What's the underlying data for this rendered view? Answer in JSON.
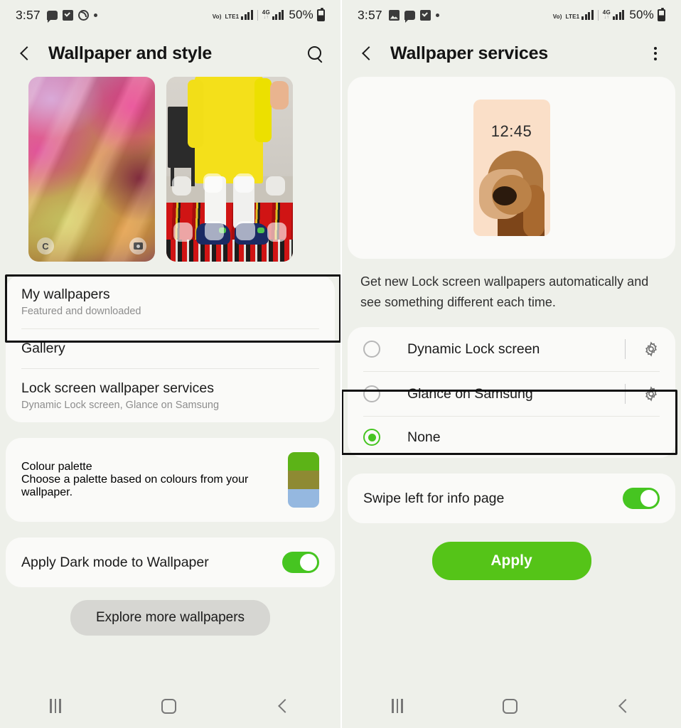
{
  "left": {
    "status_bar": {
      "time": "3:57",
      "left_icons": [
        "chat-icon",
        "checkbox-icon",
        "circle-progress-icon",
        "dot-icon"
      ],
      "network_label": "Vo)",
      "network_label2": "LTE1",
      "data_label": "4G",
      "data_arrows": "↓↑",
      "battery_percent": "50%"
    },
    "appbar": {
      "title": "Wallpaper and style",
      "back": "back-chevron",
      "search": "search-icon"
    },
    "previews": [
      {
        "name": "silk-wallpaper-thumbnail",
        "lock_glyph": "C",
        "camera_glyph": "camera-icon"
      },
      {
        "name": "photo-wallpaper-thumbnail"
      }
    ],
    "list": [
      {
        "title": "My wallpapers",
        "sub": "Featured and downloaded",
        "highlighted": true
      },
      {
        "title": "Gallery",
        "sub": ""
      },
      {
        "title": "Lock screen wallpaper services",
        "sub": "Dynamic Lock screen, Glance on Samsung"
      }
    ],
    "palette": {
      "title": "Colour palette",
      "sub": "Choose a palette based on colours from your wallpaper.",
      "swatch_colors": [
        "#5cb317",
        "#8e8a33",
        "#95b8e0"
      ]
    },
    "dark_mode": {
      "title": "Apply Dark mode to Wallpaper",
      "enabled": true
    },
    "explore_button": "Explore more wallpapers",
    "navbar": [
      "recents-button",
      "home-button",
      "back-button"
    ]
  },
  "right": {
    "status_bar": {
      "time": "3:57",
      "left_icons": [
        "image-icon",
        "chat-icon",
        "checkbox-icon",
        "dot-icon"
      ],
      "network_label": "Vo)",
      "network_label2": "LTE1",
      "data_label": "4G",
      "data_arrows": "↓↑",
      "battery_percent": "50%"
    },
    "appbar": {
      "title": "Wallpaper services",
      "back": "back-chevron",
      "menu": "kebab-menu-icon"
    },
    "preview": {
      "clock": "12:45",
      "art": "dog-illustration",
      "bg_color": "#fadfc8"
    },
    "description": "Get new Lock screen wallpapers automatically and see something different each time.",
    "options": [
      {
        "label": "Dynamic Lock screen",
        "selected": false,
        "has_settings": true
      },
      {
        "label": "Glance on Samsung",
        "selected": false,
        "has_settings": true
      },
      {
        "label": "None",
        "selected": true,
        "has_settings": false,
        "highlighted": true
      }
    ],
    "swipe_toggle": {
      "title": "Swipe left for info page",
      "enabled": true
    },
    "apply_button": "Apply",
    "navbar": [
      "recents-button",
      "home-button",
      "back-button"
    ]
  },
  "colors": {
    "accent_green": "#46c521",
    "apply_green": "#55c418",
    "bg": "#eef0ea",
    "card": "#fafaf8"
  }
}
